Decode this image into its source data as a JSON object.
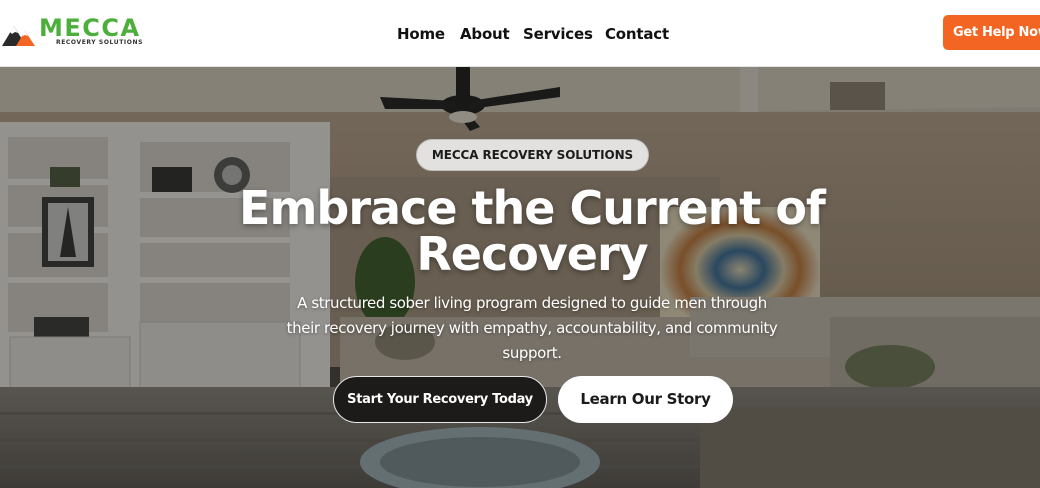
{
  "brand": {
    "name": "MECCA",
    "tagline": "RECOVERY SOLUTIONS",
    "logo_icon": "mountain-icon",
    "colors": {
      "green": "#4caf3c",
      "orange": "#f26522",
      "dark": "#2b2b2b"
    }
  },
  "nav": {
    "items": [
      {
        "label": "Home"
      },
      {
        "label": "About"
      },
      {
        "label": "Services"
      },
      {
        "label": "Contact"
      }
    ],
    "cta_label": "Get Help Now"
  },
  "hero": {
    "badge": "MECCA RECOVERY SOLUTIONS",
    "headline": "Embrace the Current of Recovery",
    "subtext": "A structured sober living program designed to guide men through their recovery journey with empathy, accountability, and community support.",
    "primary_button": "Start Your Recovery Today",
    "secondary_button": "Learn Our Story",
    "background_image": "living-room-photo",
    "logo_text_color": "#4caf3c",
    "cta_color": "#f26522"
  }
}
